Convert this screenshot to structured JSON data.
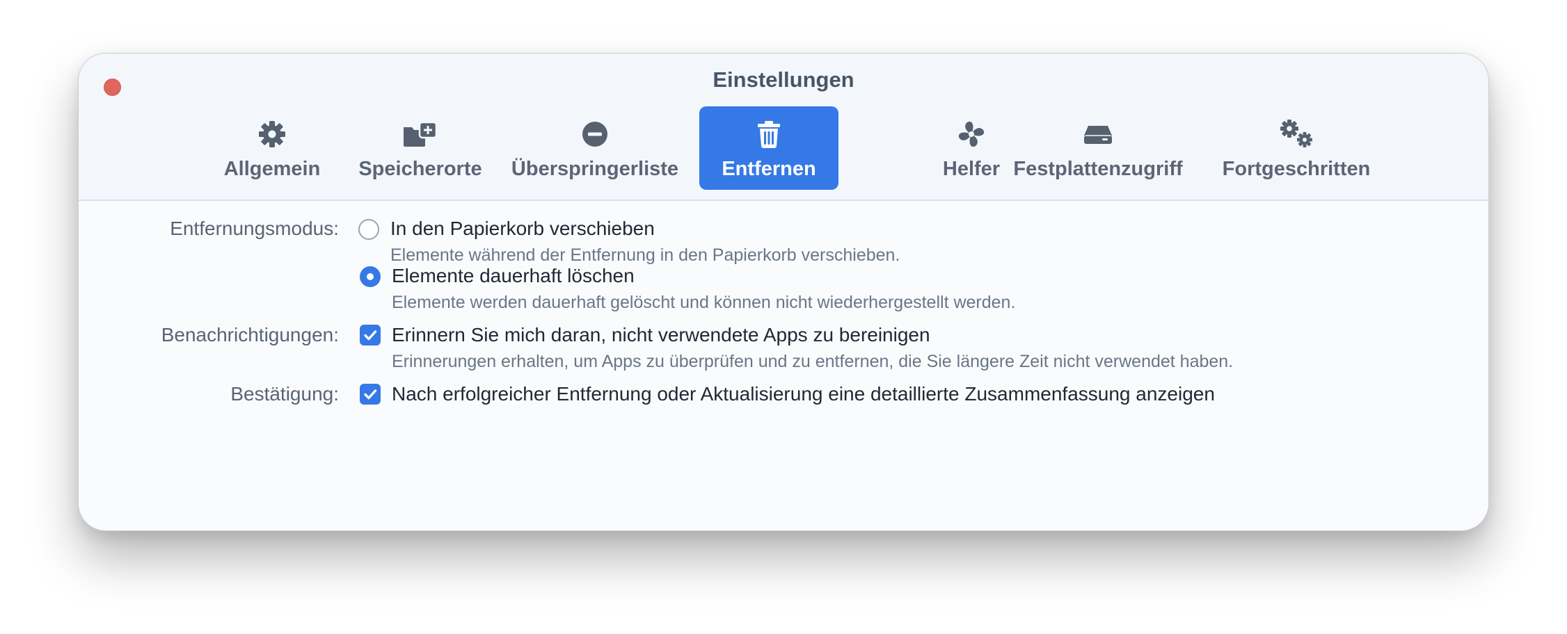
{
  "window": {
    "title": "Einstellungen"
  },
  "tabs": [
    {
      "label": "Allgemein",
      "icon": "gear-icon",
      "active": false
    },
    {
      "label": "Speicherorte",
      "icon": "folder-add-icon",
      "active": false
    },
    {
      "label": "Überspringerliste",
      "icon": "minus-circle-icon",
      "active": false
    },
    {
      "label": "Entfernen",
      "icon": "trash-icon",
      "active": true
    },
    {
      "label": "Helfer",
      "icon": "helper-icon",
      "active": false
    },
    {
      "label": "Festplattenzugriff",
      "icon": "disk-icon",
      "active": false
    },
    {
      "label": "Fortgeschritten",
      "icon": "gears-icon",
      "active": false
    }
  ],
  "removal_mode": {
    "label": "Entfernungsmodus:",
    "options": [
      {
        "title": "In den Papierkorb verschieben",
        "description": "Elemente während der Entfernung in den Papierkorb verschieben.",
        "selected": false
      },
      {
        "title": "Elemente dauerhaft löschen",
        "description": "Elemente werden dauerhaft gelöscht und können nicht wiederhergestellt werden.",
        "selected": true
      }
    ]
  },
  "notifications": {
    "label": "Benachrichtigungen:",
    "title": "Erinnern Sie mich daran, nicht verwendete Apps zu bereinigen",
    "description": "Erinnerungen erhalten, um Apps zu überprüfen und zu entfernen, die Sie längere Zeit nicht verwendet haben.",
    "checked": true
  },
  "confirmation": {
    "label": "Bestätigung:",
    "title": "Nach erfolgreicher Entfernung oder Aktualisierung eine detaillierte Zusammenfassung anzeigen",
    "checked": true
  },
  "colors": {
    "accent": "#3579e6",
    "close": "#e0665c",
    "icon": "#56606f"
  }
}
